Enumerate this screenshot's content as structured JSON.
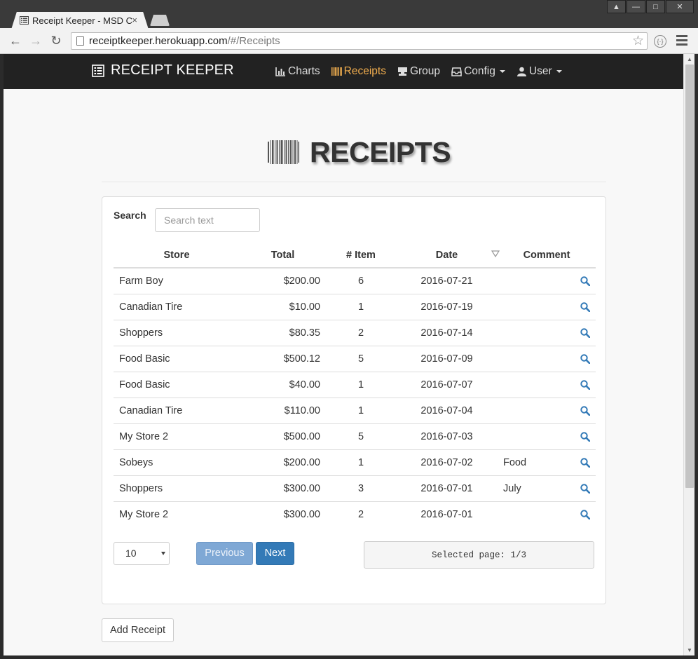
{
  "browser": {
    "tab_title": "Receipt Keeper - MSD C",
    "tab_close": "×",
    "url_host": "receiptkeeper.herokuapp.com",
    "url_path": "/#/Receipts"
  },
  "navbar": {
    "brand": "RECEIPT KEEPER",
    "links": [
      {
        "label": "Charts",
        "icon": "bar-chart-icon"
      },
      {
        "label": "Receipts",
        "icon": "barcode-icon",
        "active": true
      },
      {
        "label": "Group",
        "icon": "cashier-icon"
      },
      {
        "label": "Config",
        "icon": "inbox-icon",
        "dropdown": true
      },
      {
        "label": "User",
        "icon": "user-icon",
        "dropdown": true
      }
    ],
    "active_color": "#f0ad4e"
  },
  "page": {
    "title": "RECEIPTS"
  },
  "search": {
    "label": "Search",
    "placeholder": "Search text"
  },
  "table": {
    "columns": [
      "Store",
      "Total",
      "# Item",
      "Date",
      "Comment"
    ],
    "sorted_column": "Date",
    "rows": [
      {
        "store": "Farm Boy",
        "total": "$200.00",
        "items": "6",
        "date": "2016-07-21",
        "comment": ""
      },
      {
        "store": "Canadian Tire",
        "total": "$10.00",
        "items": "1",
        "date": "2016-07-19",
        "comment": ""
      },
      {
        "store": "Shoppers",
        "total": "$80.35",
        "items": "2",
        "date": "2016-07-14",
        "comment": ""
      },
      {
        "store": "Food Basic",
        "total": "$500.12",
        "items": "5",
        "date": "2016-07-09",
        "comment": ""
      },
      {
        "store": "Food Basic",
        "total": "$40.00",
        "items": "1",
        "date": "2016-07-07",
        "comment": ""
      },
      {
        "store": "Canadian Tire",
        "total": "$110.00",
        "items": "1",
        "date": "2016-07-04",
        "comment": ""
      },
      {
        "store": "My Store 2",
        "total": "$500.00",
        "items": "5",
        "date": "2016-07-03",
        "comment": ""
      },
      {
        "store": "Sobeys",
        "total": "$200.00",
        "items": "1",
        "date": "2016-07-02",
        "comment": "Food"
      },
      {
        "store": "Shoppers",
        "total": "$300.00",
        "items": "3",
        "date": "2016-07-01",
        "comment": "July"
      },
      {
        "store": "My Store 2",
        "total": "$300.00",
        "items": "2",
        "date": "2016-07-01",
        "comment": ""
      }
    ]
  },
  "pagination": {
    "page_size": "10",
    "previous_label": "Previous",
    "next_label": "Next",
    "status": "Selected page: 1/3"
  },
  "actions": {
    "add_label": "Add Receipt"
  },
  "colors": {
    "primary": "#337ab7",
    "primary_disabled": "#7fa8d5",
    "view_icon": "#337ab7"
  }
}
